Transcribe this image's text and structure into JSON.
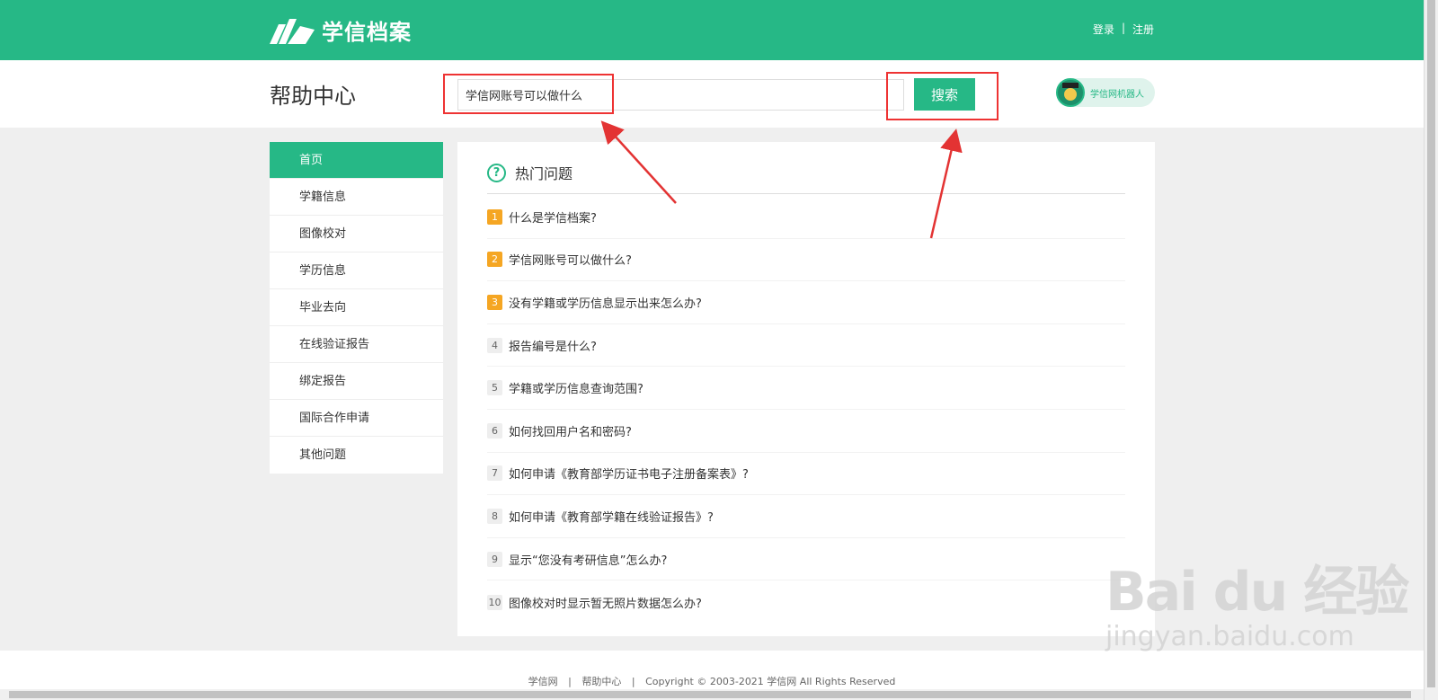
{
  "topbar": {
    "logo_text": "学信档案",
    "login": "登录",
    "separator": "|",
    "register": "注册"
  },
  "header": {
    "title": "帮助中心",
    "search_value": "学信网账号可以做什么",
    "search_button": "搜索",
    "robot_label": "学信网机器人"
  },
  "sidebar": {
    "items": [
      {
        "label": "首页",
        "active": true
      },
      {
        "label": "学籍信息"
      },
      {
        "label": "图像校对"
      },
      {
        "label": "学历信息"
      },
      {
        "label": "毕业去向"
      },
      {
        "label": "在线验证报告"
      },
      {
        "label": "绑定报告"
      },
      {
        "label": "国际合作申请"
      },
      {
        "label": "其他问题"
      }
    ]
  },
  "main": {
    "section_title": "热门问题",
    "questions": [
      {
        "num": "1",
        "text": "什么是学信档案?",
        "hot": true
      },
      {
        "num": "2",
        "text": "学信网账号可以做什么?",
        "hot": true
      },
      {
        "num": "3",
        "text": "没有学籍或学历信息显示出来怎么办?",
        "hot": true
      },
      {
        "num": "4",
        "text": "报告编号是什么?"
      },
      {
        "num": "5",
        "text": "学籍或学历信息查询范围?"
      },
      {
        "num": "6",
        "text": "如何找回用户名和密码?"
      },
      {
        "num": "7",
        "text": "如何申请《教育部学历证书电子注册备案表》?"
      },
      {
        "num": "8",
        "text": "如何申请《教育部学籍在线验证报告》?"
      },
      {
        "num": "9",
        "text": "显示“您没有考研信息”怎么办?"
      },
      {
        "num": "10",
        "text": "图像校对时显示暂无照片数据怎么办?"
      }
    ]
  },
  "footer": {
    "link1": "学信网",
    "sep": "|",
    "link2": "帮助中心",
    "copyright": "Copyright © 2003-2021 学信网 All Rights Reserved"
  },
  "watermark": {
    "logo": "Bai du 经验",
    "sub": "jingyan.baidu.com"
  },
  "colors": {
    "brand_green": "#26b886",
    "hot_orange": "#f5a623",
    "annotation_red": "#e33333"
  }
}
